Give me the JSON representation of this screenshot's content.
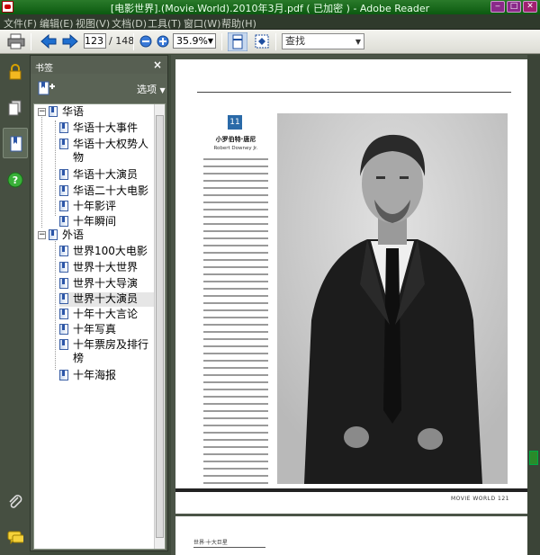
{
  "window": {
    "title": "[电影世界].(Movie.World).2010年3月.pdf ( 已加密 ) - Adobe Reader"
  },
  "menu": [
    "文件(F)",
    "编辑(E)",
    "视图(V)",
    "文档(D)",
    "工具(T)",
    "窗口(W)",
    "帮助(H)"
  ],
  "toolbar": {
    "page_current": "123",
    "page_total": "/ 148",
    "zoom": "35.9%",
    "find_placeholder": "查找"
  },
  "bookmarks": {
    "title": "书签",
    "options_label": "选项",
    "tree": [
      {
        "label": "华语",
        "children": [
          "华语十大事件",
          "华语十大权势人物",
          "华语十大演员",
          "华语二十大电影",
          "十年影评",
          "十年瞬间"
        ]
      },
      {
        "label": "外语",
        "children": [
          "世界100大电影",
          "世界十大世界",
          "世界十大导演",
          "世界十大演员",
          "十年十大言论",
          "十年写真",
          "十年票房及排行榜",
          "十年海报"
        ]
      }
    ]
  },
  "document": {
    "article_heading": "小罗伯特·唐尼",
    "article_subheading": "Robert Downey Jr.",
    "footer": "MOVIE WORLD  121",
    "next_page_heading": "世界·十大巨星"
  },
  "colors": {
    "titlebar": "#0b5a10",
    "panel": "#5a6355",
    "docbg": "#4b5447"
  }
}
